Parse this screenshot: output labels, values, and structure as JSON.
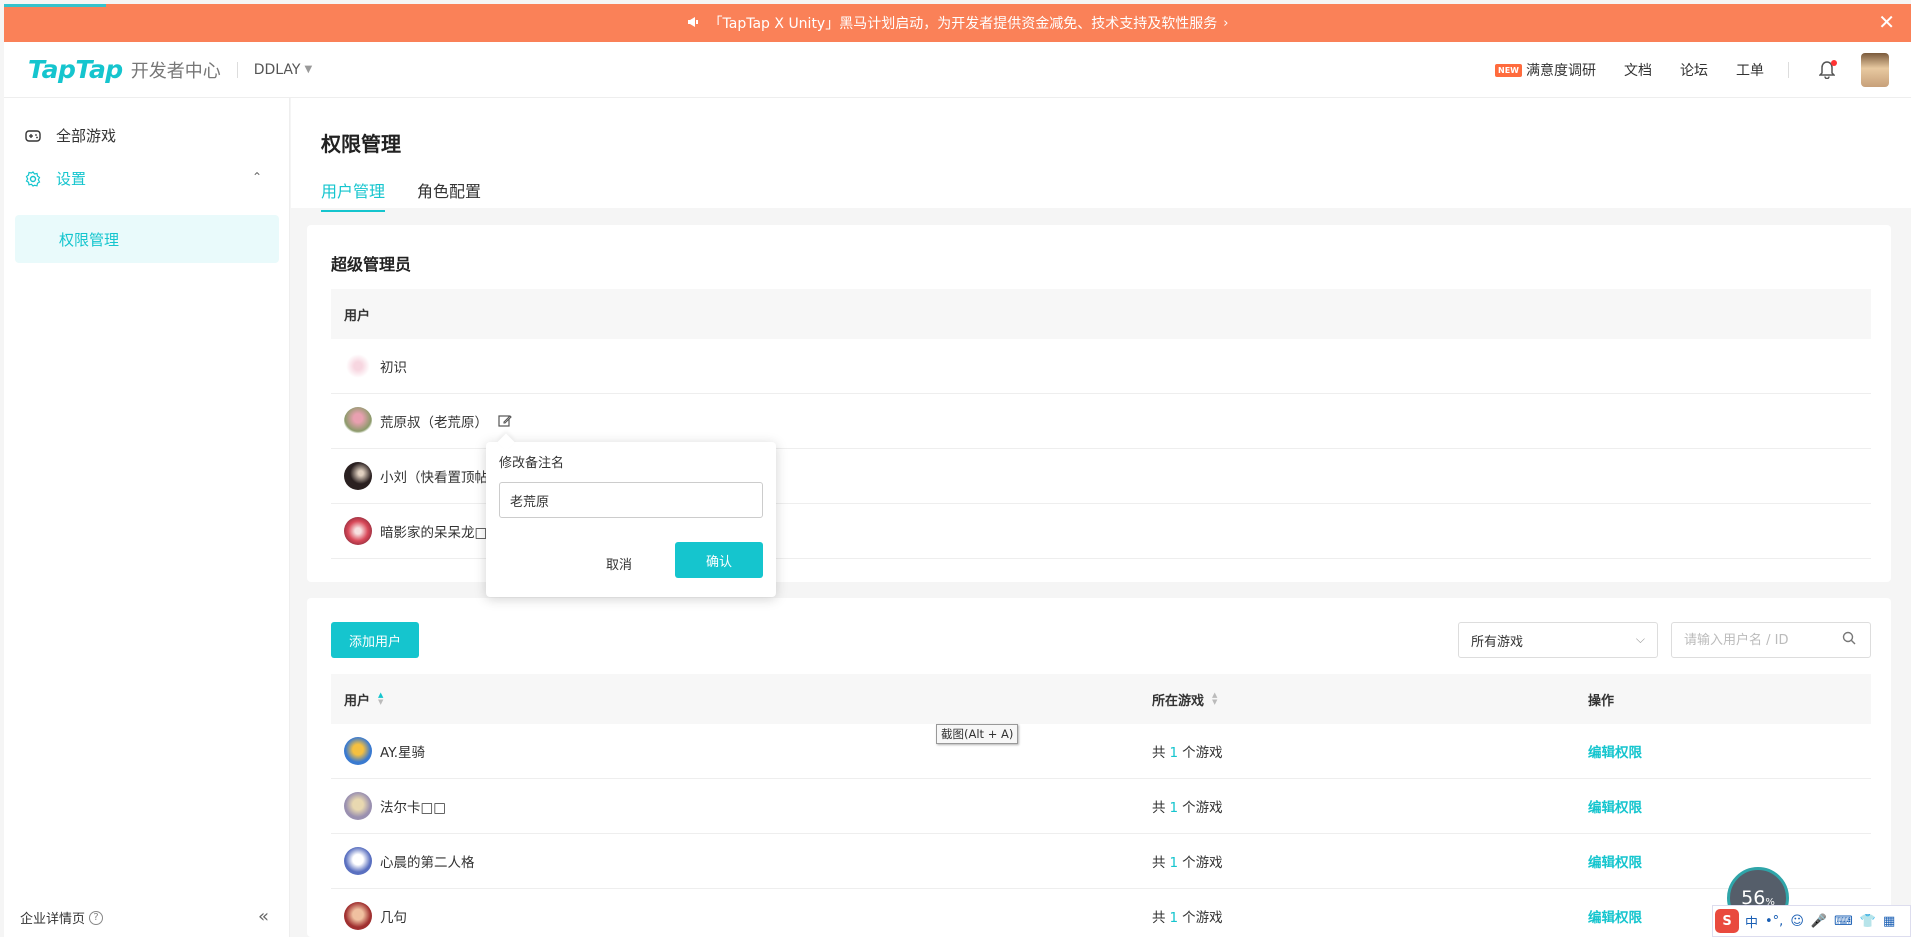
{
  "banner": {
    "text": "「TapTap X Unity」黑马计划启动，为开发者提供资金减免、技术支持及软性服务",
    "arrow": "›",
    "close": "✕"
  },
  "topnav": {
    "logo": "TapTap",
    "logo_sub": "开发者中心",
    "org": "DDLAY",
    "new_badge": "NEW",
    "survey": "满意度调研",
    "docs": "文档",
    "forum": "论坛",
    "tickets": "工单"
  },
  "sidebar": {
    "all_games": "全部游戏",
    "settings": "设置",
    "permissions": "权限管理",
    "company_page": "企业详情页",
    "collapse": "«"
  },
  "page": {
    "title": "权限管理",
    "tabs": [
      "用户管理",
      "角色配置"
    ]
  },
  "super_admins": {
    "title": "超级管理员",
    "header_user": "用户",
    "rows": [
      {
        "name": "初识"
      },
      {
        "name": "荒原叔（老荒原）"
      },
      {
        "name": "小刘（快看置顶帖"
      },
      {
        "name": "暗影家的呆呆龙□"
      }
    ]
  },
  "popover": {
    "title": "修改备注名",
    "value": "老荒原",
    "cancel": "取消",
    "confirm": "确认"
  },
  "users": {
    "add_button": "添加用户",
    "filter_selected": "所有游戏",
    "search_placeholder": "请输入用户名 / ID",
    "col_user": "用户",
    "col_games": "所在游戏",
    "col_action": "操作",
    "games_prefix": "共",
    "games_suffix": "个游戏",
    "action_label": "编辑权限",
    "rows": [
      {
        "name": "AY.星骑",
        "count": "1"
      },
      {
        "name": "法尔卡□□",
        "count": "1"
      },
      {
        "name": "心晨的第二人格",
        "count": "1"
      },
      {
        "name": "几句",
        "count": "1"
      }
    ]
  },
  "overlay": {
    "tooltip": "截图(Alt + A)",
    "progress_value": "56",
    "progress_unit": "%",
    "ime": {
      "logo": "S",
      "lang": "中",
      "punct": "•°,"
    }
  },
  "colors": {
    "accent": "#15c5ce",
    "banner": "#fa8158"
  }
}
